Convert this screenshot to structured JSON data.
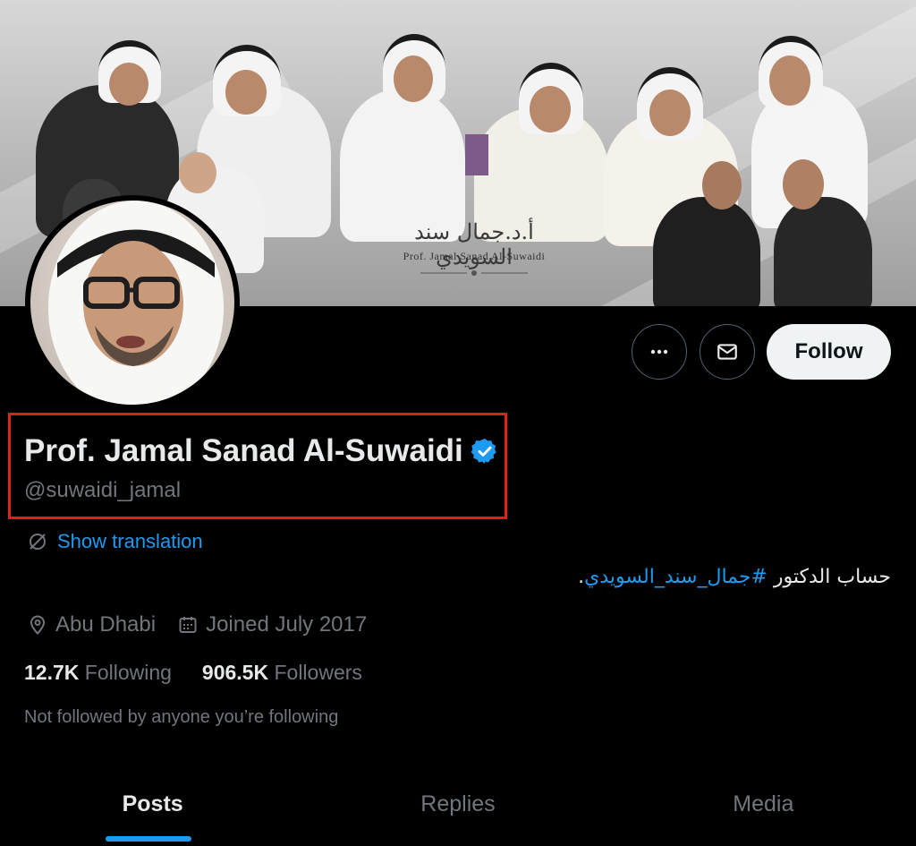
{
  "banner": {
    "calligraphy": "أ.د.جمال سند السويدي",
    "caption": "Prof. Jamal Sanad Al-Suwaidi"
  },
  "profile": {
    "display_name": "Prof. Jamal Sanad Al-Suwaidi",
    "handle": "@suwaidi_jamal",
    "verified": true,
    "bio_prefix": "حساب الدكتور ",
    "bio_hashtag": "#جمال_سند_السويدي",
    "bio_suffix": ".",
    "location": "Abu Dhabi",
    "joined": "Joined July 2017",
    "following_count": "12.7K",
    "following_label": "Following",
    "followers_count": "906.5K",
    "followers_label": "Followers",
    "not_followed_text": "Not followed by anyone you’re following"
  },
  "actions": {
    "more_icon": "more-horizontal-icon",
    "message_icon": "envelope-icon",
    "follow_label": "Follow"
  },
  "translation": {
    "icon": "translate-icon",
    "label": "Show translation"
  },
  "tabs": [
    {
      "label": "Posts",
      "active": true
    },
    {
      "label": "Replies",
      "active": false
    },
    {
      "label": "Media",
      "active": false
    }
  ],
  "colors": {
    "accent": "#1d9bf0",
    "highlight_box": "#e0211a",
    "background": "#000000",
    "secondary_text": "#71767b"
  }
}
